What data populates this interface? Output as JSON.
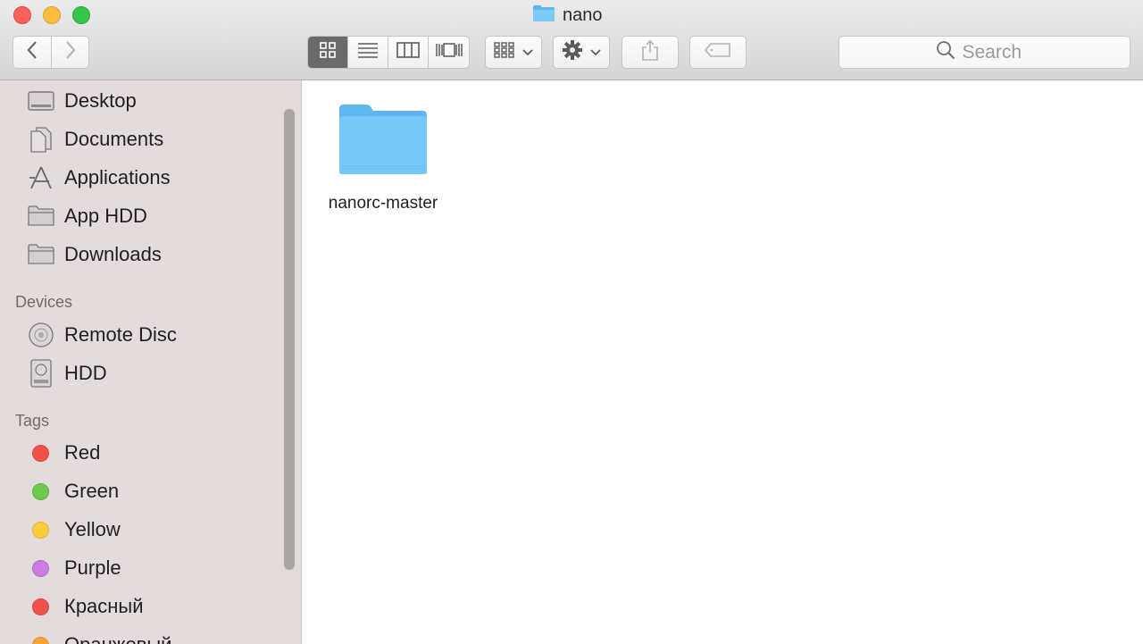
{
  "window": {
    "title": "nano",
    "title_icon": "folder-icon"
  },
  "toolbar": {
    "back": "chevron-left-icon",
    "forward": "chevron-right-icon",
    "views": [
      "icon-view-icon",
      "list-view-icon",
      "column-view-icon",
      "cover-flow-icon"
    ],
    "active_view": 0,
    "arrange": "arrange-grid-icon",
    "action": "gear-icon",
    "share": "share-icon",
    "tag": "tag-icon",
    "search_placeholder": "Search"
  },
  "sidebar": {
    "favorites": [
      {
        "label": "Desktop",
        "icon": "desktop-icon"
      },
      {
        "label": "Documents",
        "icon": "documents-icon"
      },
      {
        "label": "Applications",
        "icon": "applications-icon"
      },
      {
        "label": "App HDD",
        "icon": "folder-icon"
      },
      {
        "label": "Downloads",
        "icon": "folder-icon"
      }
    ],
    "devices_heading": "Devices",
    "devices": [
      {
        "label": "Remote Disc",
        "icon": "disc-icon"
      },
      {
        "label": "HDD",
        "icon": "hard-drive-icon"
      }
    ],
    "tags_heading": "Tags",
    "tags": [
      {
        "label": "Red",
        "color": "#f2514a"
      },
      {
        "label": "Green",
        "color": "#6ccb4f"
      },
      {
        "label": "Yellow",
        "color": "#f8ce3f"
      },
      {
        "label": "Purple",
        "color": "#cc7ee0"
      },
      {
        "label": "Красный",
        "color": "#f2514a"
      },
      {
        "label": "Оранжевый",
        "color": "#f7a33a"
      }
    ]
  },
  "content": {
    "items": [
      {
        "name": "nanorc-master",
        "icon": "folder-icon",
        "color": "#6ac5f5"
      }
    ]
  }
}
